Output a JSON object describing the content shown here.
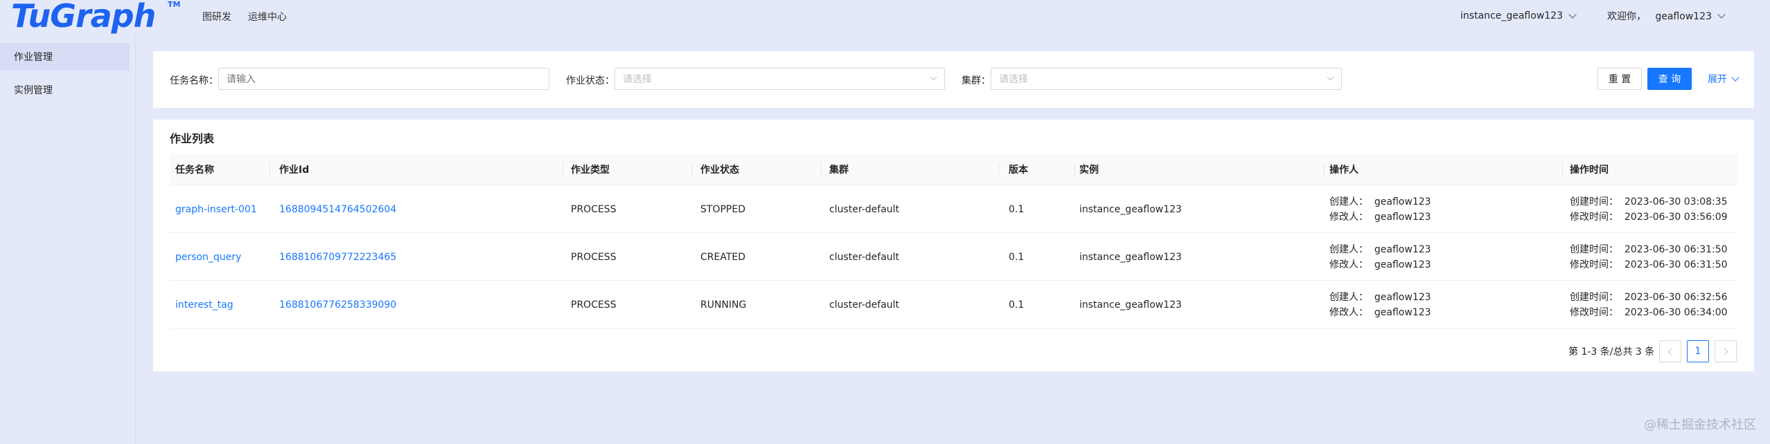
{
  "brand": {
    "logo": "TuGraph",
    "tm": "TM",
    "color": "#1d63f0"
  },
  "nav": [
    {
      "label": "图研发"
    },
    {
      "label": "运维中心"
    }
  ],
  "header_right": {
    "instance": "instance_geaflow123",
    "welcome": "欢迎你，   geaflow123"
  },
  "sidebar": {
    "items": [
      {
        "label": "作业管理",
        "active": true
      },
      {
        "label": "实例管理",
        "active": false
      }
    ]
  },
  "filter": {
    "task_name_label": "任务名称：",
    "task_name_placeholder": "请输入",
    "status_label": "作业状态：",
    "status_placeholder": "请选择",
    "cluster_label": "集群：",
    "cluster_placeholder": "请选择",
    "reset_label": "重 置",
    "query_label": "查 询",
    "expand_label": "展开"
  },
  "table": {
    "title": "作业列表",
    "columns": [
      "任务名称",
      "作业Id",
      "作业类型",
      "作业状态",
      "集群",
      "版本",
      "实例",
      "操作人",
      "操作时间"
    ],
    "rows": [
      {
        "name": "graph-insert-001",
        "id": "1688094514764502604",
        "type": "PROCESS",
        "status": "STOPPED",
        "cluster": "cluster-default",
        "version": "0.1",
        "instance": "instance_geaflow123",
        "creator": "创建人：  geaflow123",
        "modifier": "修改人：  geaflow123",
        "created": "创建时间：  2023-06-30 03:08:35",
        "modified": "修改时间：  2023-06-30 03:56:09"
      },
      {
        "name": "person_query",
        "id": "1688106709772223465",
        "type": "PROCESS",
        "status": "CREATED",
        "cluster": "cluster-default",
        "version": "0.1",
        "instance": "instance_geaflow123",
        "creator": "创建人：  geaflow123",
        "modifier": "修改人：  geaflow123",
        "created": "创建时间：  2023-06-30 06:31:50",
        "modified": "修改时间：  2023-06-30 06:31:50"
      },
      {
        "name": "interest_tag",
        "id": "1688106776258339090",
        "type": "PROCESS",
        "status": "RUNNING",
        "cluster": "cluster-default",
        "version": "0.1",
        "instance": "instance_geaflow123",
        "creator": "创建人：  geaflow123",
        "modifier": "修改人：  geaflow123",
        "created": "创建时间：  2023-06-30 06:32:56",
        "modified": "修改时间：  2023-06-30 06:34:00"
      }
    ]
  },
  "pagination": {
    "total_text": "第 1-3 条/总共 3 条",
    "current_page": "1"
  },
  "watermark": "@稀土掘金技术社区",
  "colors": {
    "accent": "#1677ff",
    "background": "#e4e9fa"
  }
}
